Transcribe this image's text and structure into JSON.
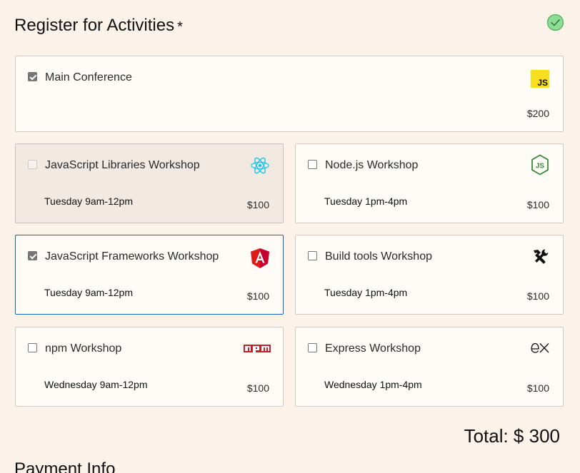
{
  "section": {
    "title": "Register for Activities",
    "required_marker": "*",
    "status_icon": "check-circle-icon",
    "status_color": "#5cc26a"
  },
  "activities": [
    {
      "name": "Main Conference",
      "time": "",
      "price": "$200",
      "checked": true,
      "disabled": false,
      "icon": "javascript-logo-icon"
    },
    {
      "name": "JavaScript Libraries Workshop",
      "time": "Tuesday 9am-12pm",
      "price": "$100",
      "checked": false,
      "disabled": true,
      "icon": "react-logo-icon"
    },
    {
      "name": "Node.js Workshop",
      "time": "Tuesday 1pm-4pm",
      "price": "$100",
      "checked": false,
      "disabled": false,
      "icon": "nodejs-logo-icon"
    },
    {
      "name": "JavaScript Frameworks Workshop",
      "time": "Tuesday 9am-12pm",
      "price": "$100",
      "checked": true,
      "disabled": false,
      "icon": "angular-logo-icon"
    },
    {
      "name": "Build tools Workshop",
      "time": "Tuesday 1pm-4pm",
      "price": "$100",
      "checked": false,
      "disabled": false,
      "icon": "tools-icon"
    },
    {
      "name": "npm Workshop",
      "time": "Wednesday 9am-12pm",
      "price": "$100",
      "checked": false,
      "disabled": false,
      "icon": "npm-logo-icon"
    },
    {
      "name": "Express Workshop",
      "time": "Wednesday 1pm-4pm",
      "price": "$100",
      "checked": false,
      "disabled": false,
      "icon": "express-logo-icon"
    }
  ],
  "total": {
    "text": "Total: $ 300"
  },
  "payment": {
    "title": "Payment Info"
  },
  "colors": {
    "focus_border": "#1565c0",
    "page_background": "#fbf2ea",
    "js_yellow": "#f7df1e",
    "react_cyan": "#1ec8e6",
    "node_green": "#3c873a",
    "angular_red": "#dd1b16",
    "npm_red": "#c12127"
  }
}
